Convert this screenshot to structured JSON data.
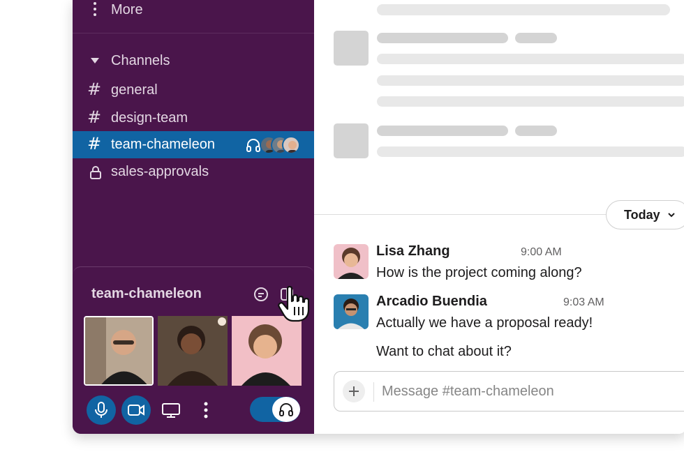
{
  "colors": {
    "sidebar": "#4a154b",
    "active": "#1164a3",
    "text_light": "#e3d7e3"
  },
  "sidebar": {
    "more_label": "More",
    "channels_label": "Channels",
    "channels": [
      {
        "name": "general",
        "icon": "hash-icon",
        "active": false
      },
      {
        "name": "design-team",
        "icon": "hash-icon",
        "active": false
      },
      {
        "name": "team-chameleon",
        "icon": "hash-icon",
        "active": true,
        "huddle": true
      },
      {
        "name": "sales-approvals",
        "icon": "lock-icon",
        "active": false
      }
    ]
  },
  "huddle": {
    "title": "team-chameleon",
    "icons": [
      "thread-icon",
      "popout-icon"
    ],
    "participants": 3,
    "controls": [
      "mic-icon",
      "video-icon",
      "screen-share-icon",
      "more-vertical-icon"
    ],
    "toggle_icon": "headphones-icon"
  },
  "main": {
    "date_label": "Today",
    "messages": [
      {
        "author": "Lisa Zhang",
        "time": "9:00 AM",
        "lines": [
          "How is the project coming along?"
        ]
      },
      {
        "author": "Arcadio Buendia",
        "time": "9:03 AM",
        "lines": [
          "Actually we have a proposal ready!",
          "Want to chat about it?"
        ]
      }
    ],
    "composer_placeholder": "Message #team-chameleon"
  }
}
